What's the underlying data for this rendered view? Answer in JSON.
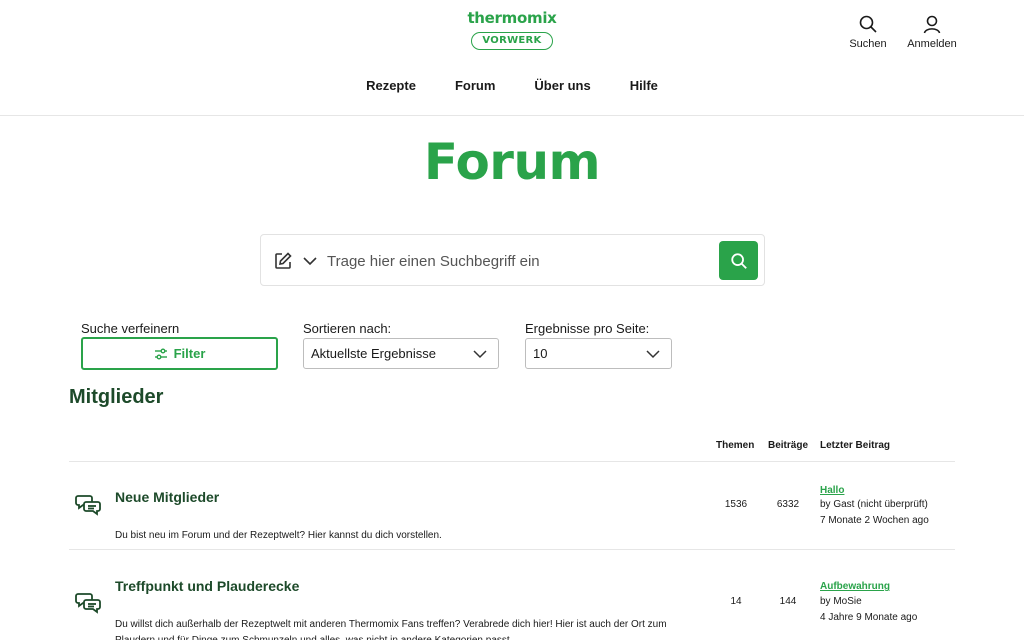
{
  "brand": {
    "name": "thermomix",
    "badge": "VORWERK",
    "color": "#2aa34a"
  },
  "header_actions": [
    {
      "label": "Suchen",
      "icon": "search-icon"
    },
    {
      "label": "Anmelden",
      "icon": "user-icon"
    }
  ],
  "nav": [
    "Rezepte",
    "Forum",
    "Über uns",
    "Hilfe"
  ],
  "page": {
    "title": "Forum"
  },
  "search": {
    "placeholder": "Trage hier einen Suchbegriff ein"
  },
  "controls": {
    "refine_label": "Suche verfeinern",
    "filter_button": "Filter",
    "sort_label": "Sortieren nach:",
    "sort_value": "Aktuellste Ergebnisse",
    "per_page_label": "Ergebnisse pro Seite:",
    "per_page_value": "10"
  },
  "section": {
    "title": "Mitglieder"
  },
  "table": {
    "headers": {
      "topics": "Themen",
      "posts": "Beiträge",
      "last": "Letzter Beitrag"
    },
    "rows": [
      {
        "name": "Neue Mitglieder",
        "description": "Du bist neu im Forum und der Rezeptwelt? Hier kannst du dich vorstellen.",
        "topics": "1536",
        "posts": "6332",
        "last_title": "Hallo",
        "last_author": "by Gast (nicht überprüft)",
        "last_time": "7 Monate 2 Wochen ago"
      },
      {
        "name": "Treffpunkt und Plauderecke",
        "description": "Du willst dich außerhalb der Rezeptwelt mit anderen Thermomix Fans treffen? Verabrede dich hier! Hier ist auch der Ort zum Plaudern und für Dinge zum Schmunzeln und alles, was nicht in andere Kategorien passt.",
        "topics": "14",
        "posts": "144",
        "last_title": "Aufbewahrung",
        "last_author": "by MoSie",
        "last_time": "4 Jahre 9 Monate ago"
      }
    ]
  }
}
